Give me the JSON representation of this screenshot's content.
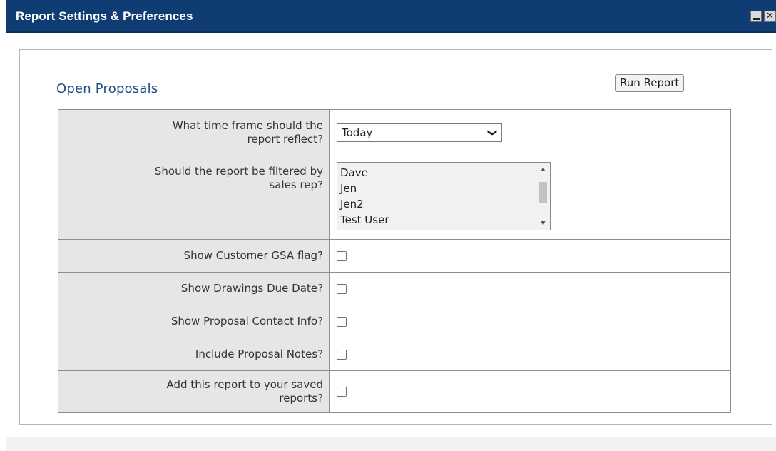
{
  "window": {
    "title": "Report Settings & Preferences"
  },
  "panel": {
    "title": "Open Proposals",
    "run_button": "Run Report"
  },
  "settings": {
    "time_frame": {
      "label": "What time frame should the report reflect?",
      "selected": "Today"
    },
    "sales_rep": {
      "label": "Should the report be filtered by sales rep?",
      "options": [
        "Dave",
        "Jen",
        "Jen2",
        "Test User"
      ]
    },
    "checkboxes": [
      {
        "label": "Show Customer GSA flag?",
        "checked": false
      },
      {
        "label": "Show Drawings Due Date?",
        "checked": false
      },
      {
        "label": "Show Proposal Contact Info?",
        "checked": false
      },
      {
        "label": "Include Proposal Notes?",
        "checked": false
      }
    ],
    "save_report": {
      "label": "Add this report to your saved reports?",
      "checked": false
    }
  },
  "colors": {
    "titlebar": "#0f3d73",
    "panel_title": "#1f4f84",
    "question_cell": "#e6e6e6"
  }
}
